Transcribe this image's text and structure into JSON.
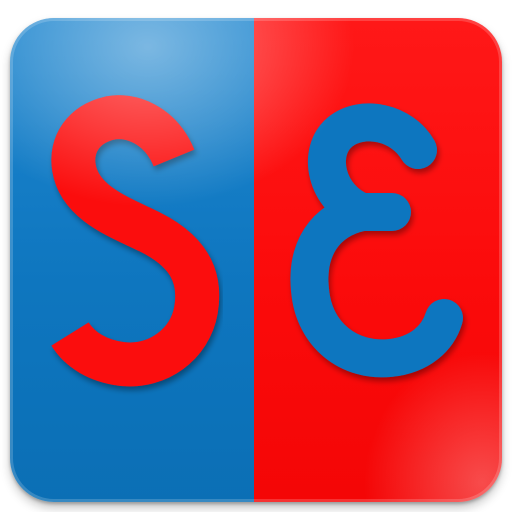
{
  "logo": {
    "text": "SE",
    "left_glyph": "S",
    "right_glyph": "E",
    "colors": {
      "blue": "#0e76bf",
      "red": "#fb0b0b",
      "background": "#ffffff"
    }
  }
}
